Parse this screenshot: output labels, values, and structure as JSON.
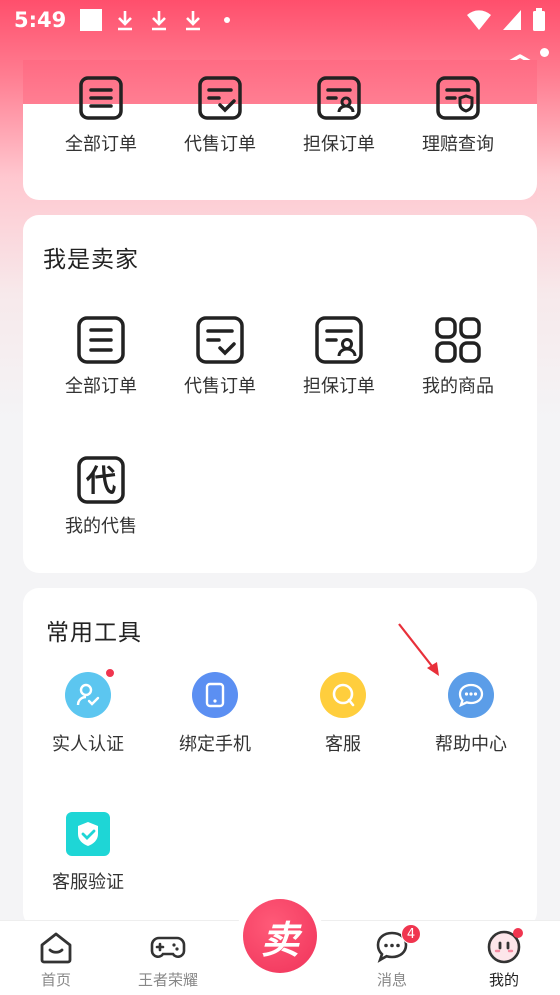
{
  "status_bar": {
    "time": "5:49"
  },
  "orders_card": {
    "items": [
      {
        "label": "全部订单",
        "icon": "list-icon"
      },
      {
        "label": "代售订单",
        "icon": "list-check-icon"
      },
      {
        "label": "担保订单",
        "icon": "list-person-icon"
      },
      {
        "label": "理赔查询",
        "icon": "list-shield-icon"
      }
    ]
  },
  "seller_card": {
    "title": "我是卖家",
    "items": [
      {
        "label": "全部订单",
        "icon": "list-icon"
      },
      {
        "label": "代售订单",
        "icon": "list-check-icon"
      },
      {
        "label": "担保订单",
        "icon": "list-person-icon"
      },
      {
        "label": "我的商品",
        "icon": "grid-icon"
      },
      {
        "label": "我的代售",
        "icon": "dai-icon",
        "icon_text": "代"
      }
    ]
  },
  "tools_card": {
    "title": "常用工具",
    "items": [
      {
        "label": "实人认证",
        "icon": "verified-user-icon",
        "color": "#5cc6f0"
      },
      {
        "label": "绑定手机",
        "icon": "phone-icon",
        "color": "#5b8ff2"
      },
      {
        "label": "客服",
        "icon": "chat-bubble-icon",
        "color": "#ffce3d"
      },
      {
        "label": "帮助中心",
        "icon": "message-dots-icon",
        "color": "#5b9de8"
      },
      {
        "label": "客服验证",
        "icon": "shield-check-icon",
        "color": "#1ed6d6"
      }
    ]
  },
  "tabbar": {
    "tabs": [
      {
        "label": "首页",
        "icon": "home-icon"
      },
      {
        "label": "王者荣耀",
        "icon": "gamepad-icon"
      },
      {
        "label": "卖",
        "icon": "sell-button"
      },
      {
        "label": "消息",
        "icon": "message-icon",
        "badge": "4"
      },
      {
        "label": "我的",
        "icon": "profile-face-icon"
      }
    ]
  },
  "colors": {
    "brand": "#f0335a",
    "header": "#ff4f6c"
  }
}
